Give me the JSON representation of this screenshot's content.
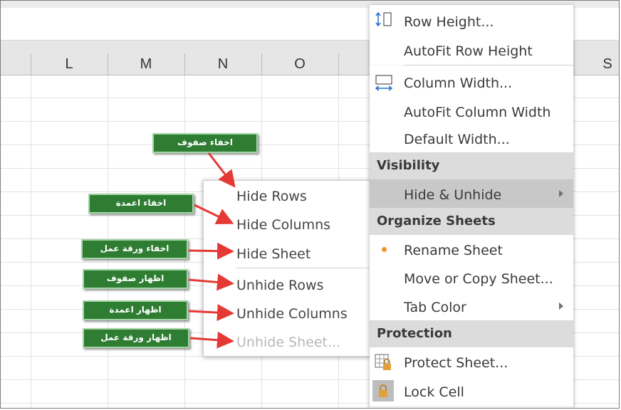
{
  "columns": {
    "L": "L",
    "M": "M",
    "N": "N",
    "O": "O",
    "S": "S"
  },
  "main_menu": {
    "row_height": "Row Height...",
    "autofit_row_height": "AutoFit Row Height",
    "column_width": "Column Width...",
    "autofit_column_width": "AutoFit Column Width",
    "default_width": "Default Width...",
    "section_visibility": "Visibility",
    "hide_unhide": "Hide & Unhide",
    "section_organize": "Organize Sheets",
    "rename_sheet": "Rename Sheet",
    "move_copy_sheet": "Move or Copy Sheet...",
    "tab_color": "Tab Color",
    "section_protection": "Protection",
    "protect_sheet": "Protect Sheet...",
    "lock_cell": "Lock Cell"
  },
  "sub_menu": {
    "hide_rows": "Hide Rows",
    "hide_columns": "Hide Columns",
    "hide_sheet": "Hide Sheet",
    "unhide_rows": "Unhide Rows",
    "unhide_columns": "Unhide Columns",
    "unhide_sheet": "Unhide Sheet..."
  },
  "annotations": {
    "hide_rows": "اخفاء صفوف",
    "hide_columns": "اخفاء اعمدة",
    "hide_sheet": "اخفاء ورقة عمل",
    "unhide_rows": "اظهار صفوف",
    "unhide_columns": "اظهار اعمدة",
    "unhide_sheet": "اظهار ورقة عمل"
  },
  "colors": {
    "annotation_bg": "#2e7d32",
    "annotation_border": "#a5d6a7",
    "arrow": "#e53935",
    "bullet": "#f0932b"
  },
  "icons": [
    "row-height-icon",
    "column-width-icon",
    "rename-bullet-icon",
    "protect-sheet-icon",
    "lock-cell-icon",
    "submenu-arrow-icon"
  ]
}
